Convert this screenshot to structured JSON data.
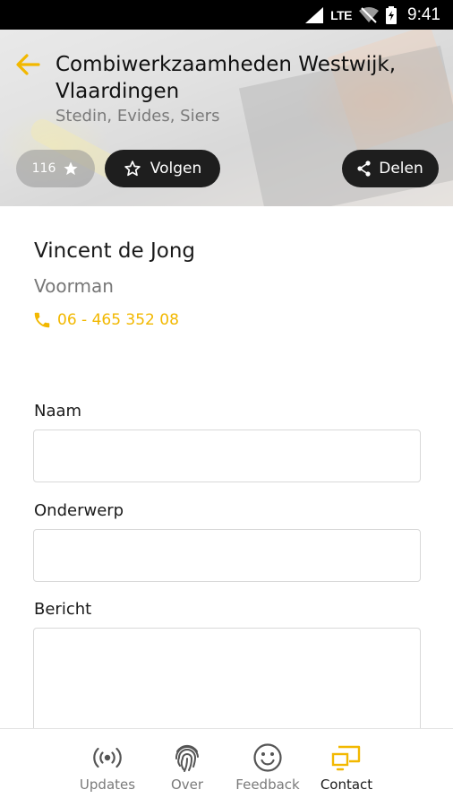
{
  "status_bar": {
    "network": "LTE",
    "time": "9:41"
  },
  "header": {
    "title": "Combiwerkzaamheden Westwijk, Vlaardingen",
    "subtitle": "Stedin, Evides, Siers",
    "star_count": "116",
    "follow_label": "Volgen",
    "share_label": "Delen"
  },
  "contact": {
    "name": "Vincent de Jong",
    "role": "Voorman",
    "phone": "06 - 465 352 08"
  },
  "form": {
    "name_label": "Naam",
    "name_value": "",
    "subject_label": "Onderwerp",
    "subject_value": "",
    "message_label": "Bericht",
    "message_value": ""
  },
  "bottom_nav": {
    "items": [
      {
        "label": "Updates",
        "icon": "broadcast-icon",
        "active": false
      },
      {
        "label": "Over",
        "icon": "fingerprint-icon",
        "active": false
      },
      {
        "label": "Feedback",
        "icon": "smiley-icon",
        "active": false
      },
      {
        "label": "Contact",
        "icon": "cast-screen-icon",
        "active": true
      }
    ]
  },
  "colors": {
    "accent": "#f2b800",
    "dark_pill": "#1e1e1e",
    "status_bar": "#000000"
  }
}
